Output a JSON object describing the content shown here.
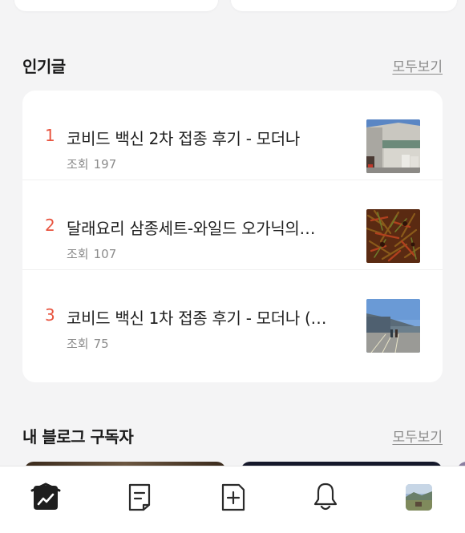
{
  "popular": {
    "title": "인기글",
    "see_all": "모두보기",
    "posts": [
      {
        "rank": "1",
        "title": "코비드 백신 2차 접종 후기 - 모더나",
        "views_label": "조회",
        "views": "197",
        "thumb": "building-photo"
      },
      {
        "rank": "2",
        "title": "달래요리 삼종세트-와일드 오가닉의…",
        "views_label": "조회",
        "views": "107",
        "thumb": "food-photo"
      },
      {
        "rank": "3",
        "title": "코비드 백신 1차 접종 후기 - 모더나 (…",
        "views_label": "조회",
        "views": "75",
        "thumb": "parking-lot-photo"
      }
    ]
  },
  "subscribers": {
    "title": "내 블로그 구독자",
    "see_all": "모두보기"
  },
  "tabbar": {
    "items": [
      {
        "name": "stats-icon",
        "active": true
      },
      {
        "name": "posts-icon",
        "active": false
      },
      {
        "name": "new-post-icon",
        "active": false
      },
      {
        "name": "bell-icon",
        "active": false
      },
      {
        "name": "profile-avatar",
        "active": false
      }
    ]
  },
  "colors": {
    "accent_rank": "#e8543f",
    "background": "#f4f4f5",
    "card": "#ffffff",
    "muted_text": "#8c8c8c"
  }
}
